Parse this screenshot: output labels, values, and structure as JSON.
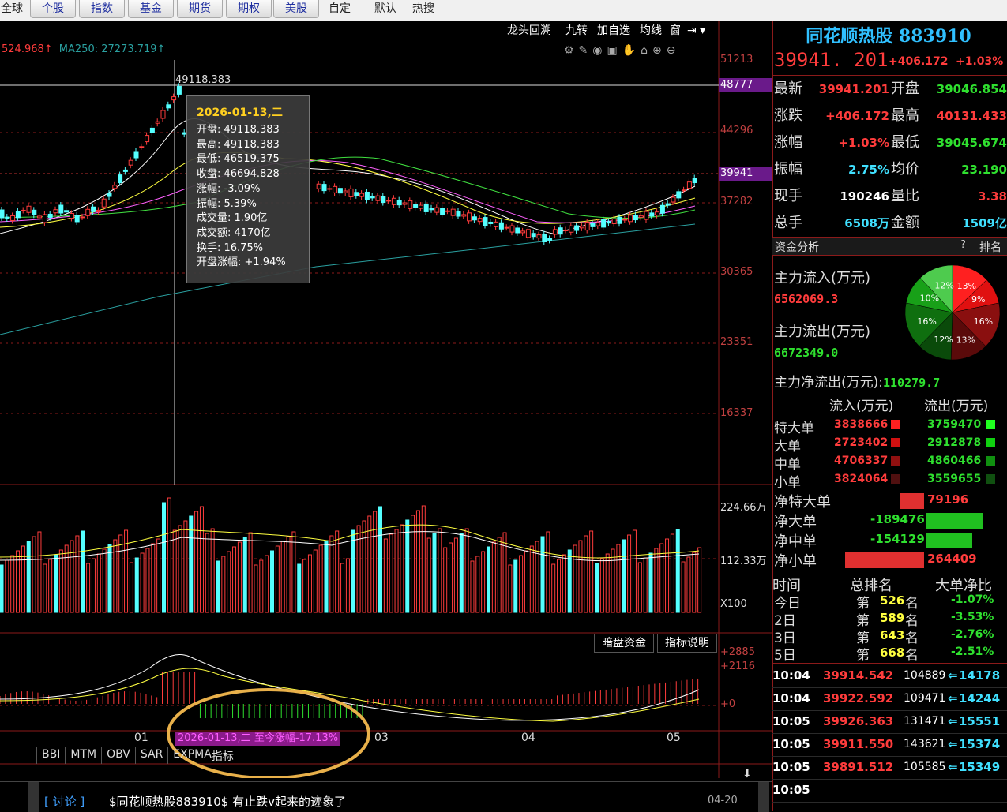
{
  "tabs": [
    "全球",
    "个股",
    "指数",
    "基金",
    "期货",
    "期权",
    "美股",
    "自定",
    "默认",
    "热搜"
  ],
  "toolbar": [
    "龙头回溯",
    "九转",
    "加自选",
    "均线",
    "窗"
  ],
  "ma_legend": {
    "ma1": "524.968↑",
    "ma250": "MA250: 27273.719↑"
  },
  "price_axis": [
    "51213",
    "48777",
    "44296",
    "39941",
    "37282",
    "30365",
    "23351",
    "16337"
  ],
  "peak_label": "49118.383",
  "tooltip": {
    "date": "2026-01-13,二",
    "rows": [
      "开盘: 49118.383",
      "最高: 49118.383",
      "最低: 46519.375",
      "收盘: 46694.828",
      "涨幅: -3.09%",
      "振幅: 5.39%",
      "成交量: 1.90亿",
      "成交额: 4170亿",
      "换手: 16.75%",
      "开盘涨幅: +1.94%"
    ]
  },
  "volume_axis": [
    "224.66万",
    "112.33万",
    "X100"
  ],
  "macd_axis": [
    "+2885",
    "+2116",
    "+0"
  ],
  "macd_buttons": [
    "暗盘资金",
    "指标说明"
  ],
  "date_ticks": [
    "01",
    "03",
    "04",
    "05"
  ],
  "range_label": "2026-01-13,二 至今涨幅-17.13%",
  "indicator_tabs": [
    "BBI",
    "MTM",
    "OBV",
    "SAR",
    "EXPMA",
    "指标"
  ],
  "news": {
    "bracket": "[ 讨论 ]",
    "text": "$同花顺热股883910$ 有止跌v起来的迹象了",
    "date": "04-20"
  },
  "quote": {
    "title": "同花顺热股 883910",
    "price": "39941. 201",
    "change": "+406.172",
    "pct": "+1.03%",
    "rows": [
      {
        "l1": "最新",
        "v1": "39941.201",
        "c1": "red",
        "l2": "开盘",
        "v2": "39046.854",
        "c2": "green"
      },
      {
        "l1": "涨跌",
        "v1": "+406.172",
        "c1": "red",
        "l2": "最高",
        "v2": "40131.433",
        "c2": "red"
      },
      {
        "l1": "涨幅",
        "v1": "+1.03%",
        "c1": "red",
        "l2": "最低",
        "v2": "39045.674",
        "c2": "green"
      },
      {
        "l1": "振幅",
        "v1": "2.75%",
        "c1": "cyan",
        "l2": "均价",
        "v2": "23.190",
        "c2": "green"
      },
      {
        "l1": "现手",
        "v1": "190246",
        "c1": "white",
        "l2": "量比",
        "v2": "3.38",
        "c2": "red"
      },
      {
        "l1": "总手",
        "v1": "6508万",
        "c1": "cyan",
        "l2": "金额",
        "v2": "1509亿",
        "c2": "cyan"
      }
    ]
  },
  "funds": {
    "header": "资金分析",
    "help": "?",
    "rank": "排名",
    "inflow_label": "主力流入(万元)",
    "inflow_value": "6562069.3",
    "outflow_label": "主力流出(万元)",
    "outflow_value": "6672349.0",
    "net_label": "主力净流出(万元):",
    "net_value": "110279.7",
    "pie": [
      "12%",
      "13%",
      "10%",
      "9%",
      "16%",
      "16%",
      "12%",
      "13%"
    ],
    "col_in": "流入(万元)",
    "col_out": "流出(万元)",
    "orders": [
      {
        "name": "特大单",
        "in": "3838666",
        "out": "3759470"
      },
      {
        "name": "大单",
        "in": "2723402",
        "out": "2912878"
      },
      {
        "name": "中单",
        "in": "4706337",
        "out": "4860466"
      },
      {
        "name": "小单",
        "in": "3824064",
        "out": "3559655"
      }
    ],
    "net": [
      {
        "name": "净特大单",
        "value": "79196",
        "sign": 1,
        "magnitude": 0.3
      },
      {
        "name": "净大单",
        "value": "-189476",
        "sign": -1,
        "magnitude": 0.72
      },
      {
        "name": "净中单",
        "value": "-154129",
        "sign": -1,
        "magnitude": 0.59
      },
      {
        "name": "净小单",
        "value": "264409",
        "sign": 1,
        "magnitude": 1.0
      }
    ]
  },
  "ranking": {
    "headers": [
      "时间",
      "总排名",
      "大单净比"
    ],
    "rows": [
      {
        "t": "今日",
        "rank": "526",
        "ratio": "-1.07%"
      },
      {
        "t": "2日",
        "rank": "589",
        "ratio": "-3.53%"
      },
      {
        "t": "3日",
        "rank": "643",
        "ratio": "-2.76%"
      },
      {
        "t": "5日",
        "rank": "668",
        "ratio": "-2.51%"
      }
    ],
    "prefix": "第",
    "suffix": "名"
  },
  "ticks": [
    {
      "time": "10:04",
      "price": "39914.542",
      "vol": "104889",
      "amt": "14178"
    },
    {
      "time": "10:04",
      "price": "39922.592",
      "vol": "109471",
      "amt": "14244"
    },
    {
      "time": "10:05",
      "price": "39926.363",
      "vol": "131471",
      "amt": "15551"
    },
    {
      "time": "10:05",
      "price": "39911.550",
      "vol": "143621",
      "amt": "15374"
    },
    {
      "time": "10:05",
      "price": "39891.512",
      "vol": "105585",
      "amt": "15349"
    },
    {
      "time": "10:05",
      "price": "",
      "vol": "",
      "amt": ""
    }
  ],
  "colors": {
    "up": "#ff3c3c",
    "down": "#54ffff",
    "macd_down": "#2fe02f",
    "accent": "#e8b04a",
    "grid": "#8b1a1a"
  }
}
